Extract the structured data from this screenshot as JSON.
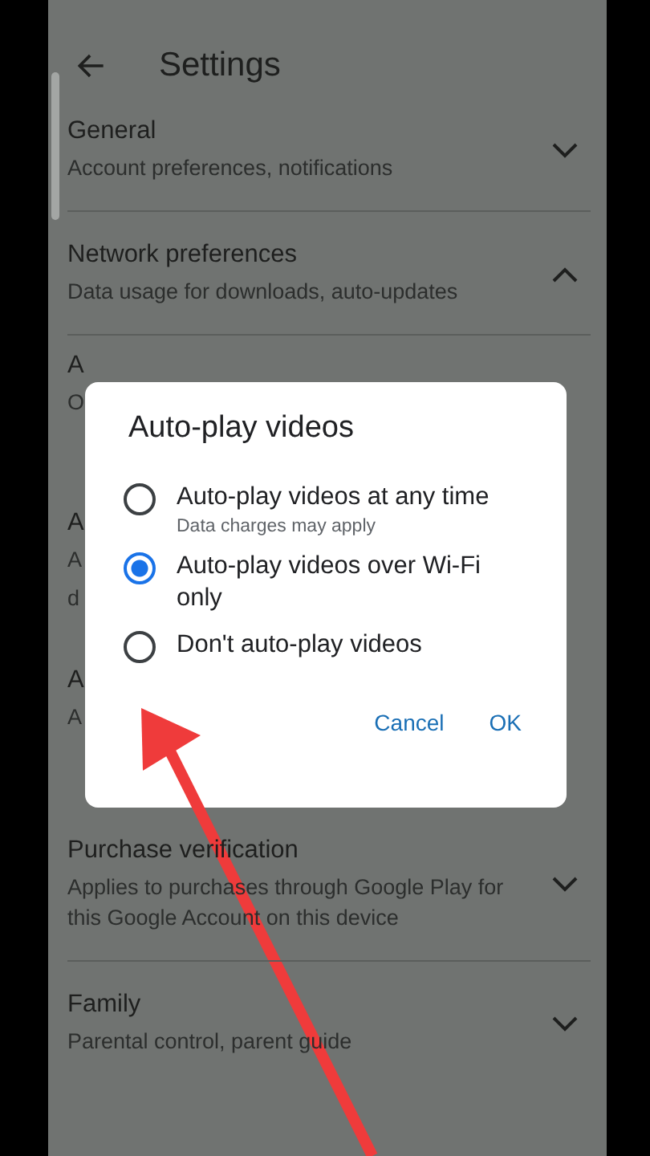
{
  "header": {
    "title": "Settings"
  },
  "sections": [
    {
      "kind": "full",
      "title": "General",
      "subtitle": "Account preferences, notifications",
      "expanded": false
    },
    {
      "kind": "full",
      "title": "Network preferences",
      "subtitle": "Data usage for downloads, auto-updates",
      "expanded": true
    },
    {
      "kind": "covered",
      "lines": [
        "A",
        "O"
      ]
    },
    {
      "kind": "covered",
      "lines": [
        "A",
        "A",
        "d"
      ]
    },
    {
      "kind": "covered",
      "lines": [
        "A",
        "A"
      ]
    },
    {
      "kind": "full",
      "title": "Purchase verification",
      "subtitle": "Applies to purchases through Google Play for this Google Account on this device",
      "expanded": false
    },
    {
      "kind": "full",
      "title": "Family",
      "subtitle": "Parental control, parent guide",
      "expanded": false
    }
  ],
  "dialog": {
    "title": "Auto-play videos",
    "options": [
      {
        "label": "Auto-play videos at any time",
        "note": "Data charges may apply",
        "selected": false
      },
      {
        "label": "Auto-play videos over Wi-Fi only",
        "selected": true
      },
      {
        "label": "Don't auto-play videos",
        "selected": false
      }
    ],
    "buttons": [
      "Cancel",
      "OK"
    ]
  }
}
